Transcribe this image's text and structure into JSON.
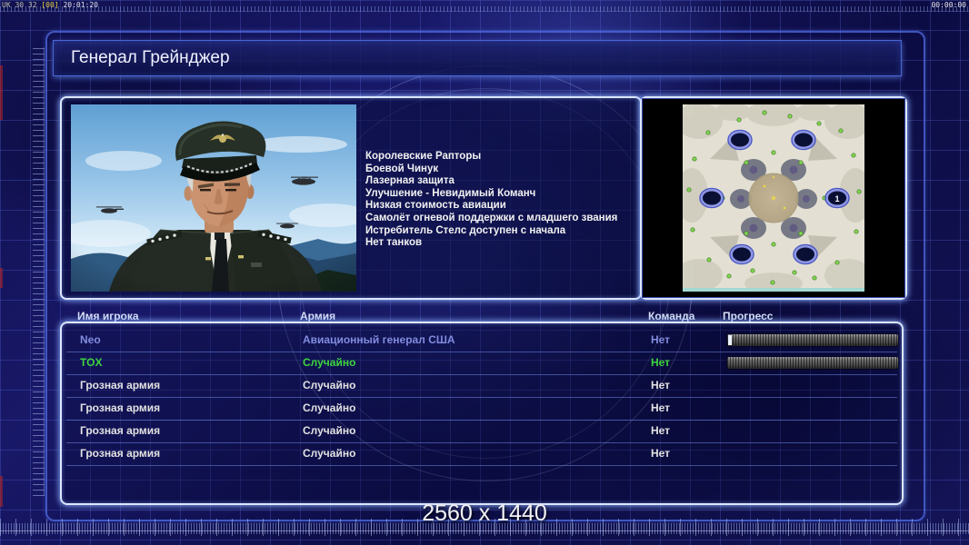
{
  "overlay": {
    "debug_prefix": "UK 30 32",
    "debug_bracket": "[00]",
    "debug_time": "20:01:20",
    "timer": "00:00:00"
  },
  "header": {
    "title": "Генерал Грейнджер"
  },
  "general": {
    "abilities": [
      "Королевские Рапторы",
      "Боевой Чинук",
      "Лазерная защита",
      "Улучшение - Невидимый Команч",
      "Низкая стоимость авиации",
      "Самолёт огневой поддержки с младшего звания",
      "Истребитель Стелс доступен с начала",
      "Нет танков"
    ]
  },
  "map": {
    "spawn_label": "1"
  },
  "table": {
    "columns": [
      "Имя игрока",
      "Армия",
      "Команда",
      "Прогресс"
    ],
    "rows": [
      {
        "name": "Neo",
        "army": "Авиационный генерал США",
        "team": "Нет"
      },
      {
        "name": "TOX",
        "army": "Случайно",
        "team": "Нет"
      },
      {
        "name": "Грозная армия",
        "army": "Случайно",
        "team": "Нет"
      },
      {
        "name": "Грозная армия",
        "army": "Случайно",
        "team": "Нет"
      },
      {
        "name": "Грозная армия",
        "army": "Случайно",
        "team": "Нет"
      },
      {
        "name": "Грозная армия",
        "army": "Случайно",
        "team": "Нет"
      }
    ]
  },
  "footer": {
    "resolution": "2560 x 1440"
  },
  "colors": {
    "player1_text": "#828cdf",
    "player2_text": "#3ed43e",
    "row_text": "#e2e2e2",
    "panel_glow": "#dce6ff",
    "background": "#10104e"
  }
}
